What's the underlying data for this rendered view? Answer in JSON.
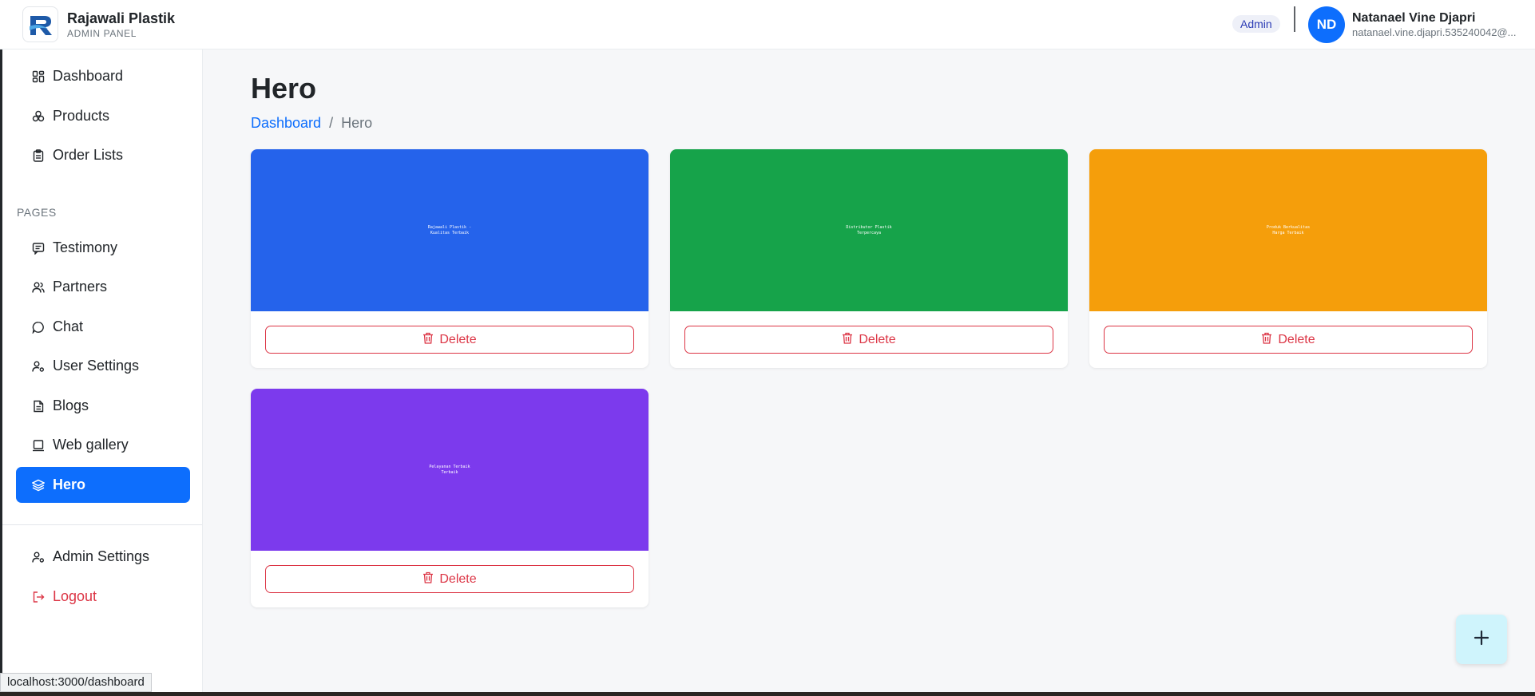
{
  "header": {
    "brand_name": "Rajawali Plastik",
    "brand_sub": "ADMIN PANEL",
    "role_badge": "Admin",
    "avatar_initials": "ND",
    "user_name": "Natanael Vine Djapri",
    "user_email": "natanael.vine.djapri.535240042@..."
  },
  "sidebar": {
    "items": [
      {
        "label": "Dashboard",
        "icon": "dashboard-icon"
      },
      {
        "label": "Products",
        "icon": "products-icon"
      },
      {
        "label": "Order Lists",
        "icon": "clipboard-icon"
      }
    ],
    "section_title": "PAGES",
    "pages": [
      {
        "label": "Testimony",
        "icon": "testimony-icon"
      },
      {
        "label": "Partners",
        "icon": "people-icon"
      },
      {
        "label": "Chat",
        "icon": "chat-icon"
      },
      {
        "label": "User Settings",
        "icon": "user-gear-icon"
      },
      {
        "label": "Blogs",
        "icon": "document-icon"
      },
      {
        "label": "Web gallery",
        "icon": "gallery-icon"
      },
      {
        "label": "Hero",
        "icon": "layers-icon",
        "active": true
      }
    ],
    "bottom": [
      {
        "label": "Admin Settings",
        "icon": "admin-gear-icon"
      },
      {
        "label": "Logout",
        "icon": "logout-icon"
      }
    ]
  },
  "main": {
    "title": "Hero",
    "breadcrumb": {
      "link": "Dashboard",
      "separator": "/",
      "current": "Hero"
    },
    "cards": [
      {
        "color": "#2563eb",
        "caption_line1": "Rajawali Plastik -",
        "caption_line2": "Kualitas Terbaik",
        "delete_label": "Delete"
      },
      {
        "color": "#16a34a",
        "caption_line1": "Distributor Plastik",
        "caption_line2": "Terpercaya",
        "delete_label": "Delete"
      },
      {
        "color": "#f59e0b",
        "caption_line1": "Produk Berkualitas",
        "caption_line2": "Harga Terbaik",
        "delete_label": "Delete"
      },
      {
        "color": "#7c3aed",
        "caption_line1": "Pelayanan Terbaik",
        "caption_line2": "Terbaik",
        "delete_label": "Delete"
      }
    ],
    "fab_label": "+"
  },
  "status_bar": {
    "url": "localhost:3000/dashboard"
  },
  "colors": {
    "primary": "#0d6efd",
    "danger": "#dc3545",
    "fab_bg": "#cff4fc"
  }
}
